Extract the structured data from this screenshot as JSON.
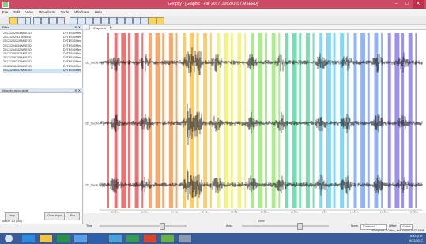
{
  "window": {
    "title": "Geopsy - [Graphic - File 20171206201037.MSEED]",
    "minimize": "–",
    "maximize": "□",
    "close": "✕"
  },
  "menu": [
    "File",
    "Edit",
    "View",
    "Waveform",
    "Tools",
    "Windows",
    "Help"
  ],
  "toolbar": {
    "icons": [
      "open-icon",
      "save-icon",
      "dropdown-icon",
      "view-table-icon",
      "view-graphic-icon",
      "view-map-icon",
      "view-chart-icon",
      "zoom-icon",
      "pick-icon",
      "filter-icon",
      "spectrum-icon",
      "rotate-icon",
      "cut-icon",
      "merge-icon",
      "stack-icon",
      "export-icon",
      "config-icon",
      "run-icon"
    ]
  },
  "files_panel": {
    "title": "Files",
    "controls": "✕ ✕",
    "rows": [
      {
        "name": "20171202003.MSEED",
        "path": "D:/TESIS/Men..."
      },
      {
        "name": "20171202111.MSEED",
        "path": "D:/TESIS/Men..."
      },
      {
        "name": "20171202219.MSEED",
        "path": "D:/TESIS/Men..."
      },
      {
        "name": "20171204034.MSEED",
        "path": "D:/TESIS/Men..."
      },
      {
        "name": "20171204142.MSEED",
        "path": "D:/TESIS/Men..."
      },
      {
        "name": "20171206152.MSEED",
        "path": "D:/TESIS/Men..."
      },
      {
        "name": "20171206208.MSEED",
        "path": "D:/TESIS/Men..."
      },
      {
        "name": "20171206322.MSEED",
        "path": "D:/TESIS/Men..."
      },
      {
        "name": "20171206430.MSEED",
        "path": "D:/TESIS/Men..."
      },
      {
        "name": "20171206537.MSEED",
        "path": "D:/TESIS/Men..."
      }
    ]
  },
  "waveform_console": {
    "title": "Waveform console",
    "controls": "✕ ✕"
  },
  "buttons": {
    "help": "Help",
    "clear_steps": "Clear steps",
    "run": "Run"
  },
  "status": {
    "left": "Station 1/3 (low)",
    "right": "45 signals, 10 files, free cache 9433.6 MB"
  },
  "tabs": {
    "graphic": "Graphic",
    "close": "✕",
    "add": "+"
  },
  "plot": {
    "channels": [
      "1D_Dec B",
      "1D_Dec N",
      "1D_Dec E"
    ],
    "ticks": [
      "00h10m",
      "02h00m",
      "04h00m",
      "06h00m",
      "08h00m",
      "10h00m",
      "12h00m",
      "1/12",
      "16h00m",
      "18h00m",
      "20h00m"
    ],
    "xlabel": "Time",
    "colors": [
      "#ec5a5a",
      "#f49a52",
      "#f6c454",
      "#eef07a",
      "#9fe57e",
      "#62d6a6",
      "#6ed0f0",
      "#7ea8f2",
      "#8b7fe8"
    ]
  },
  "bottom_controls": {
    "time_label": "Time",
    "amp_label": "Ampl.",
    "norm_label": "Norm.",
    "norm_value": "Common",
    "offset_label": "Offset",
    "offset_value": "Global"
  },
  "taskbar": {
    "clock_time": "8:43 p.m.",
    "clock_date": "6/12/2017"
  }
}
